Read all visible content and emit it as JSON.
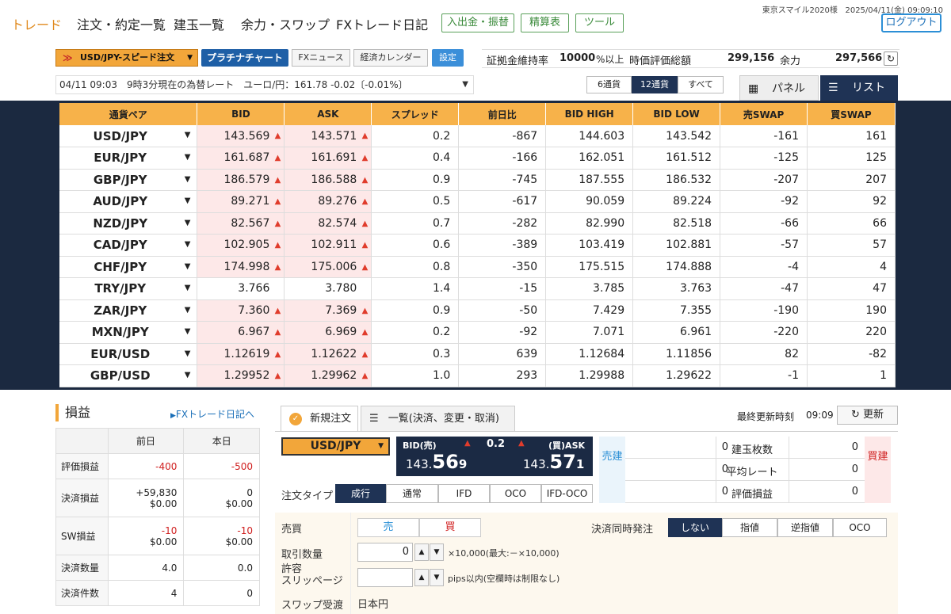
{
  "account": {
    "user": "東京スマイル2020様",
    "datetime": "2025/04/11(金) 09:09:10"
  },
  "nav": {
    "items": [
      "トレード",
      "注文・約定一覧",
      "建玉一覧",
      "余力・スワップ",
      "FXトレード日記"
    ],
    "green_buttons": [
      "入出金・振替",
      "精算表",
      "ツール"
    ],
    "logout": "ログアウト"
  },
  "toolbar": {
    "pair_select": "USD/JPY-スピード注文",
    "platinum_chart": "プラチナチャート",
    "fx_news": "FXニュース",
    "calendar": "経済カレンダー",
    "settings": "設定"
  },
  "summary": {
    "margin_label": "証拠金維持率",
    "margin_value": "10000",
    "margin_suffix": "%以上",
    "valuation_label": "時価評価総額",
    "valuation_value": "299,156",
    "power_label": "余力",
    "power_value": "297,566"
  },
  "ticker": "04/11 09:03　9時3分現在の為替レート　ユーロ/円：161.78 -0.02〔-0.01%〕",
  "pair_count": {
    "options": [
      "6通貨",
      "12通貨",
      "すべて"
    ],
    "selected": "12通貨"
  },
  "view": {
    "panel": "パネル",
    "list": "リスト"
  },
  "rates": {
    "headers": [
      "通貨ペア",
      "BID",
      "ASK",
      "スプレッド",
      "前日比",
      "BID HIGH",
      "BID LOW",
      "売SWAP",
      "買SWAP"
    ],
    "rows": [
      {
        "pair": "USD/JPY",
        "bid": "143.569",
        "ask": "143.571",
        "spread": "0.2",
        "change": "-867",
        "high": "144.603",
        "low": "143.542",
        "sell_swap": "-161",
        "buy_swap": "161",
        "up": true
      },
      {
        "pair": "EUR/JPY",
        "bid": "161.687",
        "ask": "161.691",
        "spread": "0.4",
        "change": "-166",
        "high": "162.051",
        "low": "161.512",
        "sell_swap": "-125",
        "buy_swap": "125",
        "up": true
      },
      {
        "pair": "GBP/JPY",
        "bid": "186.579",
        "ask": "186.588",
        "spread": "0.9",
        "change": "-745",
        "high": "187.555",
        "low": "186.532",
        "sell_swap": "-207",
        "buy_swap": "207",
        "up": true
      },
      {
        "pair": "AUD/JPY",
        "bid": "89.271",
        "ask": "89.276",
        "spread": "0.5",
        "change": "-617",
        "high": "90.059",
        "low": "89.224",
        "sell_swap": "-92",
        "buy_swap": "92",
        "up": true
      },
      {
        "pair": "NZD/JPY",
        "bid": "82.567",
        "ask": "82.574",
        "spread": "0.7",
        "change": "-282",
        "high": "82.990",
        "low": "82.518",
        "sell_swap": "-66",
        "buy_swap": "66",
        "up": true
      },
      {
        "pair": "CAD/JPY",
        "bid": "102.905",
        "ask": "102.911",
        "spread": "0.6",
        "change": "-389",
        "high": "103.419",
        "low": "102.881",
        "sell_swap": "-57",
        "buy_swap": "57",
        "up": true
      },
      {
        "pair": "CHF/JPY",
        "bid": "174.998",
        "ask": "175.006",
        "spread": "0.8",
        "change": "-350",
        "high": "175.515",
        "low": "174.888",
        "sell_swap": "-4",
        "buy_swap": "4",
        "up": true
      },
      {
        "pair": "TRY/JPY",
        "bid": "3.766",
        "ask": "3.780",
        "spread": "1.4",
        "change": "-15",
        "high": "3.785",
        "low": "3.763",
        "sell_swap": "-47",
        "buy_swap": "47",
        "up": false
      },
      {
        "pair": "ZAR/JPY",
        "bid": "7.360",
        "ask": "7.369",
        "spread": "0.9",
        "change": "-50",
        "high": "7.429",
        "low": "7.355",
        "sell_swap": "-190",
        "buy_swap": "190",
        "up": true
      },
      {
        "pair": "MXN/JPY",
        "bid": "6.967",
        "ask": "6.969",
        "spread": "0.2",
        "change": "-92",
        "high": "7.071",
        "low": "6.961",
        "sell_swap": "-220",
        "buy_swap": "220",
        "up": true
      },
      {
        "pair": "EUR/USD",
        "bid": "1.12619",
        "ask": "1.12622",
        "spread": "0.3",
        "change": "639",
        "high": "1.12684",
        "low": "1.11856",
        "sell_swap": "82",
        "buy_swap": "-82",
        "up": true
      },
      {
        "pair": "GBP/USD",
        "bid": "1.29952",
        "ask": "1.29962",
        "spread": "1.0",
        "change": "293",
        "high": "1.29988",
        "low": "1.29622",
        "sell_swap": "-1",
        "buy_swap": "1",
        "up": true
      }
    ]
  },
  "pl": {
    "title": "損益",
    "link": "FXトレード日記へ",
    "col_prev": "前日",
    "col_today": "本日",
    "rows": [
      {
        "label": "評価損益",
        "prev": "-400",
        "today": "-500",
        "neg": true
      },
      {
        "label": "決済損益",
        "prev": "+59,830",
        "prev2": "$0.00",
        "today": "0",
        "today2": "$0.00",
        "neg": false
      },
      {
        "label": "SW損益",
        "prev": "-10",
        "prev2": "$0.00",
        "today": "-10",
        "today2": "$0.00",
        "neg": true
      },
      {
        "label": "決済数量",
        "prev": "4.0",
        "today": "0.0",
        "neg": false
      },
      {
        "label": "決済件数",
        "prev": "4",
        "today": "0",
        "neg": false
      }
    ]
  },
  "order": {
    "tab_new": "新規注文",
    "tab_list": "一覧(決済、変更・取消)",
    "last_update_label": "最終更新時刻",
    "last_update": "09:09",
    "refresh": "更新",
    "pair": "USD/JPY",
    "bid_label": "BID(売)",
    "ask_label": "(買)ASK",
    "spread": "0.2",
    "bid_main": "143.",
    "bid_big": "56",
    "bid_small": "9",
    "ask_main": "143.",
    "ask_big": "57",
    "ask_small": "1",
    "sell_label": "売建",
    "buy_label": "買建",
    "pos_labels": [
      "建玉枚数",
      "平均レート",
      "評価損益"
    ],
    "sell_vals": [
      "0",
      "0",
      "0"
    ],
    "buy_vals": [
      "0",
      "0",
      "0"
    ],
    "order_type_label": "注文タイプ",
    "order_types": [
      "成行",
      "通常",
      "IFD",
      "OCO",
      "IFD-OCO"
    ],
    "side_label": "売買",
    "sell": "売",
    "buy": "買",
    "qty_label": "取引数量",
    "qty": "0",
    "qty_hint": "×10,000(最大:－×10,000)",
    "slip_label": "許容\nスリッページ",
    "slip_hint": "pips以内(空欄時は制限なし)",
    "swap_label": "スワップ受渡",
    "swap_value": "日本円",
    "settle_label": "決済同時発注",
    "settle_opts": [
      "しない",
      "指値",
      "逆指値",
      "OCO"
    ]
  }
}
